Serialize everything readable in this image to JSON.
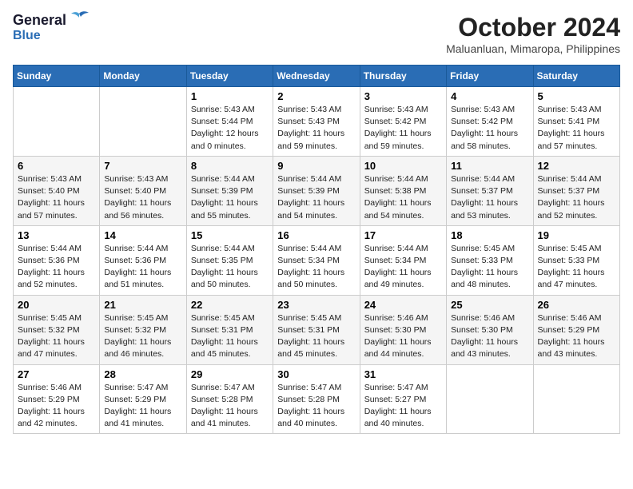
{
  "logo": {
    "line1": "General",
    "line2": "Blue"
  },
  "title": "October 2024",
  "location": "Maluanluan, Mimaropa, Philippines",
  "days_of_week": [
    "Sunday",
    "Monday",
    "Tuesday",
    "Wednesday",
    "Thursday",
    "Friday",
    "Saturday"
  ],
  "weeks": [
    [
      {
        "day": "",
        "info": ""
      },
      {
        "day": "",
        "info": ""
      },
      {
        "day": "1",
        "info": "Sunrise: 5:43 AM\nSunset: 5:44 PM\nDaylight: 12 hours\nand 0 minutes."
      },
      {
        "day": "2",
        "info": "Sunrise: 5:43 AM\nSunset: 5:43 PM\nDaylight: 11 hours\nand 59 minutes."
      },
      {
        "day": "3",
        "info": "Sunrise: 5:43 AM\nSunset: 5:42 PM\nDaylight: 11 hours\nand 59 minutes."
      },
      {
        "day": "4",
        "info": "Sunrise: 5:43 AM\nSunset: 5:42 PM\nDaylight: 11 hours\nand 58 minutes."
      },
      {
        "day": "5",
        "info": "Sunrise: 5:43 AM\nSunset: 5:41 PM\nDaylight: 11 hours\nand 57 minutes."
      }
    ],
    [
      {
        "day": "6",
        "info": "Sunrise: 5:43 AM\nSunset: 5:40 PM\nDaylight: 11 hours\nand 57 minutes."
      },
      {
        "day": "7",
        "info": "Sunrise: 5:43 AM\nSunset: 5:40 PM\nDaylight: 11 hours\nand 56 minutes."
      },
      {
        "day": "8",
        "info": "Sunrise: 5:44 AM\nSunset: 5:39 PM\nDaylight: 11 hours\nand 55 minutes."
      },
      {
        "day": "9",
        "info": "Sunrise: 5:44 AM\nSunset: 5:39 PM\nDaylight: 11 hours\nand 54 minutes."
      },
      {
        "day": "10",
        "info": "Sunrise: 5:44 AM\nSunset: 5:38 PM\nDaylight: 11 hours\nand 54 minutes."
      },
      {
        "day": "11",
        "info": "Sunrise: 5:44 AM\nSunset: 5:37 PM\nDaylight: 11 hours\nand 53 minutes."
      },
      {
        "day": "12",
        "info": "Sunrise: 5:44 AM\nSunset: 5:37 PM\nDaylight: 11 hours\nand 52 minutes."
      }
    ],
    [
      {
        "day": "13",
        "info": "Sunrise: 5:44 AM\nSunset: 5:36 PM\nDaylight: 11 hours\nand 52 minutes."
      },
      {
        "day": "14",
        "info": "Sunrise: 5:44 AM\nSunset: 5:36 PM\nDaylight: 11 hours\nand 51 minutes."
      },
      {
        "day": "15",
        "info": "Sunrise: 5:44 AM\nSunset: 5:35 PM\nDaylight: 11 hours\nand 50 minutes."
      },
      {
        "day": "16",
        "info": "Sunrise: 5:44 AM\nSunset: 5:34 PM\nDaylight: 11 hours\nand 50 minutes."
      },
      {
        "day": "17",
        "info": "Sunrise: 5:44 AM\nSunset: 5:34 PM\nDaylight: 11 hours\nand 49 minutes."
      },
      {
        "day": "18",
        "info": "Sunrise: 5:45 AM\nSunset: 5:33 PM\nDaylight: 11 hours\nand 48 minutes."
      },
      {
        "day": "19",
        "info": "Sunrise: 5:45 AM\nSunset: 5:33 PM\nDaylight: 11 hours\nand 47 minutes."
      }
    ],
    [
      {
        "day": "20",
        "info": "Sunrise: 5:45 AM\nSunset: 5:32 PM\nDaylight: 11 hours\nand 47 minutes."
      },
      {
        "day": "21",
        "info": "Sunrise: 5:45 AM\nSunset: 5:32 PM\nDaylight: 11 hours\nand 46 minutes."
      },
      {
        "day": "22",
        "info": "Sunrise: 5:45 AM\nSunset: 5:31 PM\nDaylight: 11 hours\nand 45 minutes."
      },
      {
        "day": "23",
        "info": "Sunrise: 5:45 AM\nSunset: 5:31 PM\nDaylight: 11 hours\nand 45 minutes."
      },
      {
        "day": "24",
        "info": "Sunrise: 5:46 AM\nSunset: 5:30 PM\nDaylight: 11 hours\nand 44 minutes."
      },
      {
        "day": "25",
        "info": "Sunrise: 5:46 AM\nSunset: 5:30 PM\nDaylight: 11 hours\nand 43 minutes."
      },
      {
        "day": "26",
        "info": "Sunrise: 5:46 AM\nSunset: 5:29 PM\nDaylight: 11 hours\nand 43 minutes."
      }
    ],
    [
      {
        "day": "27",
        "info": "Sunrise: 5:46 AM\nSunset: 5:29 PM\nDaylight: 11 hours\nand 42 minutes."
      },
      {
        "day": "28",
        "info": "Sunrise: 5:47 AM\nSunset: 5:29 PM\nDaylight: 11 hours\nand 41 minutes."
      },
      {
        "day": "29",
        "info": "Sunrise: 5:47 AM\nSunset: 5:28 PM\nDaylight: 11 hours\nand 41 minutes."
      },
      {
        "day": "30",
        "info": "Sunrise: 5:47 AM\nSunset: 5:28 PM\nDaylight: 11 hours\nand 40 minutes."
      },
      {
        "day": "31",
        "info": "Sunrise: 5:47 AM\nSunset: 5:27 PM\nDaylight: 11 hours\nand 40 minutes."
      },
      {
        "day": "",
        "info": ""
      },
      {
        "day": "",
        "info": ""
      }
    ]
  ]
}
